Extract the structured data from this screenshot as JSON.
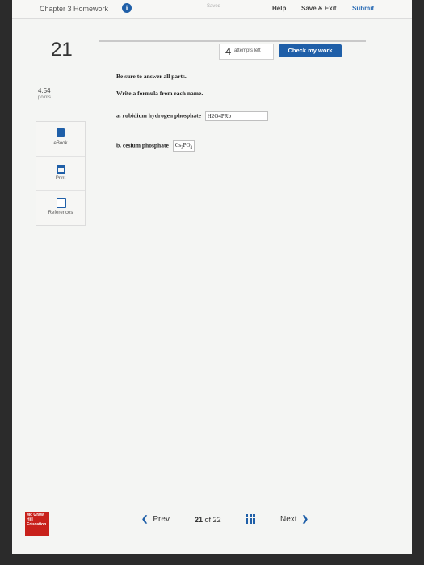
{
  "header": {
    "title": "Chapter 3 Homework",
    "info_icon": "i",
    "saved_status": "Saved",
    "help_label": "Help",
    "save_exit_label": "Save & Exit",
    "submit_label": "Submit"
  },
  "question": {
    "number": "21",
    "attempts_count": "4",
    "attempts_label": "attempts left",
    "check_label": "Check my work",
    "points_value": "4.54",
    "points_label": "points"
  },
  "sidebar": {
    "items": [
      {
        "label": "eBook",
        "icon": "book-icon"
      },
      {
        "label": "Print",
        "icon": "printer-icon"
      },
      {
        "label": "References",
        "icon": "references-icon"
      }
    ]
  },
  "content": {
    "instruction": "Be sure to answer all parts.",
    "prompt": "Write a formula from each name.",
    "part_a_label": "a. rubidium hydrogen phosphate",
    "part_a_answer": "H2O4PRb",
    "part_b_label": "b. cesium phosphate",
    "part_b_answer_cs": "Cs",
    "part_b_answer_cs_sub": "3",
    "part_b_answer_po": "PO",
    "part_b_answer_po_sub": "4"
  },
  "footer": {
    "logo_text": "Mc Graw Hill Education",
    "prev_label": "Prev",
    "page_current": "21",
    "page_of": "of",
    "page_total": "22",
    "next_label": "Next"
  },
  "colors": {
    "accent": "#1f5fa8",
    "logo_red": "#c8211b"
  }
}
